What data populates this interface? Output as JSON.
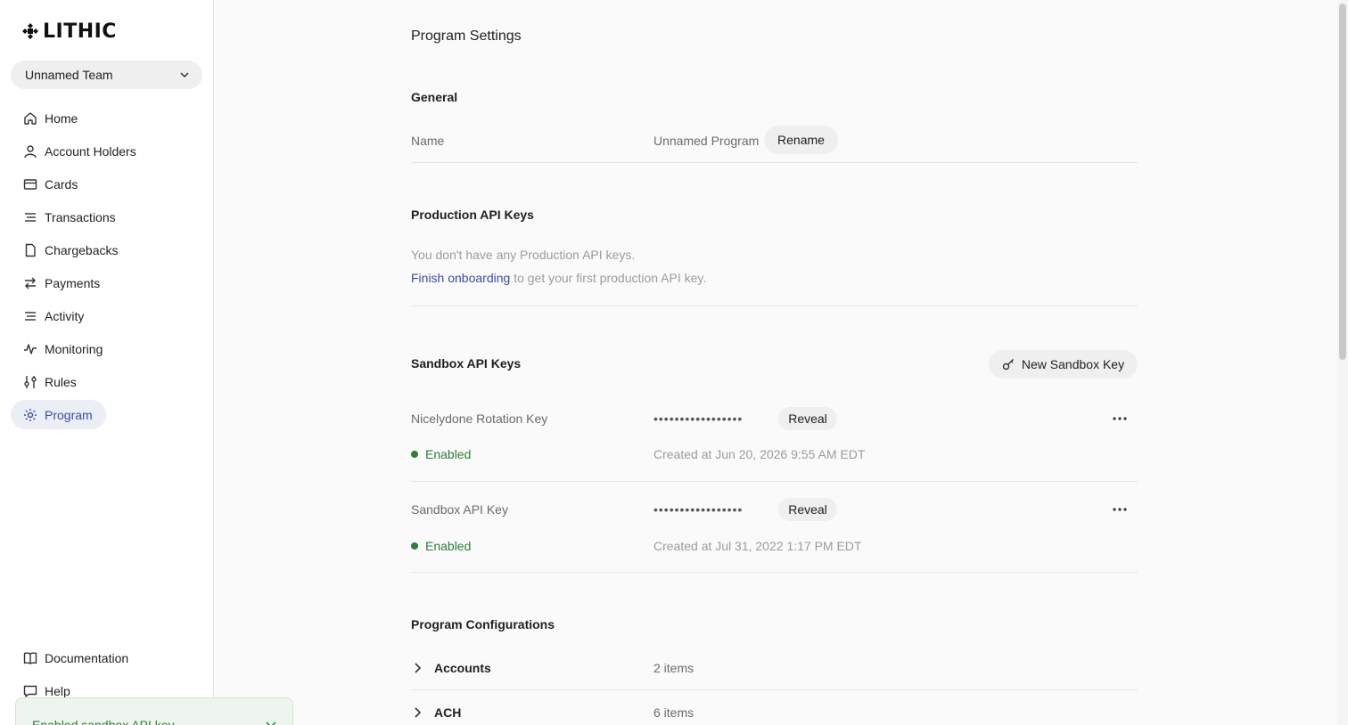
{
  "sidebar": {
    "logo": "LITHIC",
    "team": "Unnamed Team",
    "items": [
      {
        "label": "Home",
        "icon": "home-icon"
      },
      {
        "label": "Account Holders",
        "icon": "user-icon"
      },
      {
        "label": "Cards",
        "icon": "card-icon"
      },
      {
        "label": "Transactions",
        "icon": "list-icon"
      },
      {
        "label": "Chargebacks",
        "icon": "document-icon"
      },
      {
        "label": "Payments",
        "icon": "arrows-icon"
      },
      {
        "label": "Activity",
        "icon": "list-icon"
      },
      {
        "label": "Monitoring",
        "icon": "pulse-icon"
      },
      {
        "label": "Rules",
        "icon": "sliders-icon"
      },
      {
        "label": "Program",
        "icon": "gear-icon",
        "active": true
      }
    ],
    "bottom": [
      {
        "label": "Documentation",
        "icon": "book-icon"
      },
      {
        "label": "Help",
        "icon": "chat-icon"
      }
    ]
  },
  "toast": {
    "message": "Enabled sandbox API key"
  },
  "main": {
    "title": "Program Settings",
    "general": {
      "title": "General",
      "name_label": "Name",
      "name_value": "Unnamed Program",
      "rename_button": "Rename"
    },
    "production": {
      "title": "Production API Keys",
      "empty_text": "You don't have any Production API keys.",
      "link_text": "Finish onboarding",
      "link_suffix": "to get your first production API key."
    },
    "sandbox": {
      "title": "Sandbox API Keys",
      "new_button": "New Sandbox Key",
      "keys": [
        {
          "name": "Nicelydone Rotation Key",
          "masked": "•••••••••••••••••",
          "reveal": "Reveal",
          "status": "Enabled",
          "created": "Created at Jun 20, 2026 9:55 AM EDT"
        },
        {
          "name": "Sandbox API Key",
          "masked": "•••••••••••••••••",
          "reveal": "Reveal",
          "status": "Enabled",
          "created": "Created at Jul 31, 2022 1:17 PM EDT"
        }
      ]
    },
    "configurations": {
      "title": "Program Configurations",
      "rows": [
        {
          "name": "Accounts",
          "count": "2 items"
        },
        {
          "name": "ACH",
          "count": "6 items"
        }
      ]
    }
  },
  "colors": {
    "accent": "#3d4ba3",
    "success": "#2e7d3a",
    "muted": "#9c9c9c"
  }
}
